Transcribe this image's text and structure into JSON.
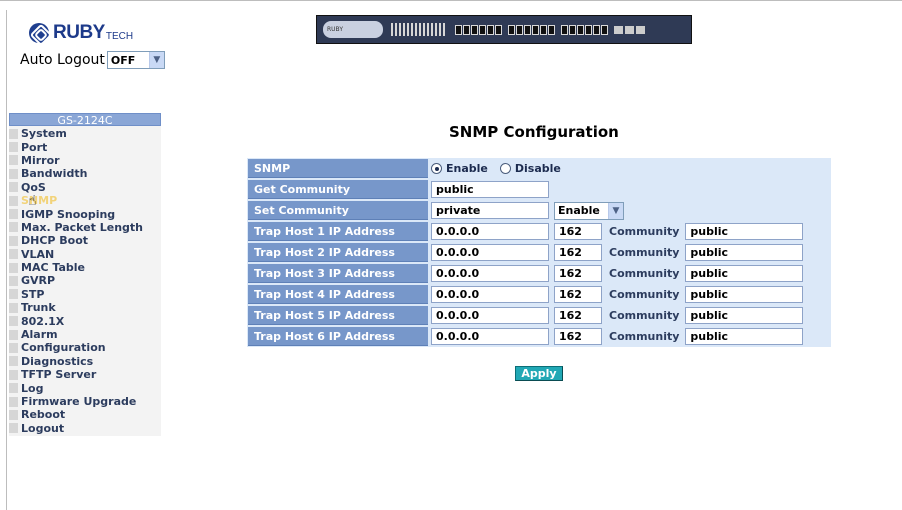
{
  "brand": {
    "name": "RUBY",
    "sub": "TECH"
  },
  "auto_logout": {
    "label": "Auto Logout",
    "value": "OFF"
  },
  "device": {
    "badge_text": "RUBY"
  },
  "nav": {
    "title": "GS-2124C",
    "items": [
      {
        "label": "System"
      },
      {
        "label": "Port"
      },
      {
        "label": "Mirror"
      },
      {
        "label": "Bandwidth"
      },
      {
        "label": "QoS"
      },
      {
        "label": "SNMP"
      },
      {
        "label": "IGMP Snooping"
      },
      {
        "label": "Max. Packet Length"
      },
      {
        "label": "DHCP Boot"
      },
      {
        "label": "VLAN"
      },
      {
        "label": "MAC Table"
      },
      {
        "label": "GVRP"
      },
      {
        "label": "STP"
      },
      {
        "label": "Trunk"
      },
      {
        "label": "802.1X"
      },
      {
        "label": "Alarm"
      },
      {
        "label": "Configuration"
      },
      {
        "label": "Diagnostics"
      },
      {
        "label": "TFTP Server"
      },
      {
        "label": "Log"
      },
      {
        "label": "Firmware Upgrade"
      },
      {
        "label": "Reboot"
      },
      {
        "label": "Logout"
      }
    ]
  },
  "main": {
    "title": "SNMP Configuration",
    "snmp": {
      "label": "SNMP",
      "enable": "Enable",
      "disable": "Disable",
      "selected": "Enable"
    },
    "get_community": {
      "label": "Get Community",
      "value": "public"
    },
    "set_community": {
      "label": "Set Community",
      "value": "private",
      "state": "Enable"
    },
    "community_label": "Community",
    "trap_hosts": [
      {
        "label": "Trap Host 1 IP Address",
        "ip": "0.0.0.0",
        "port": "162",
        "community": "public"
      },
      {
        "label": "Trap Host 2 IP Address",
        "ip": "0.0.0.0",
        "port": "162",
        "community": "public"
      },
      {
        "label": "Trap Host 3 IP Address",
        "ip": "0.0.0.0",
        "port": "162",
        "community": "public"
      },
      {
        "label": "Trap Host 4 IP Address",
        "ip": "0.0.0.0",
        "port": "162",
        "community": "public"
      },
      {
        "label": "Trap Host 5 IP Address",
        "ip": "0.0.0.0",
        "port": "162",
        "community": "public"
      },
      {
        "label": "Trap Host 6 IP Address",
        "ip": "0.0.0.0",
        "port": "162",
        "community": "public"
      }
    ],
    "apply_label": "Apply"
  }
}
